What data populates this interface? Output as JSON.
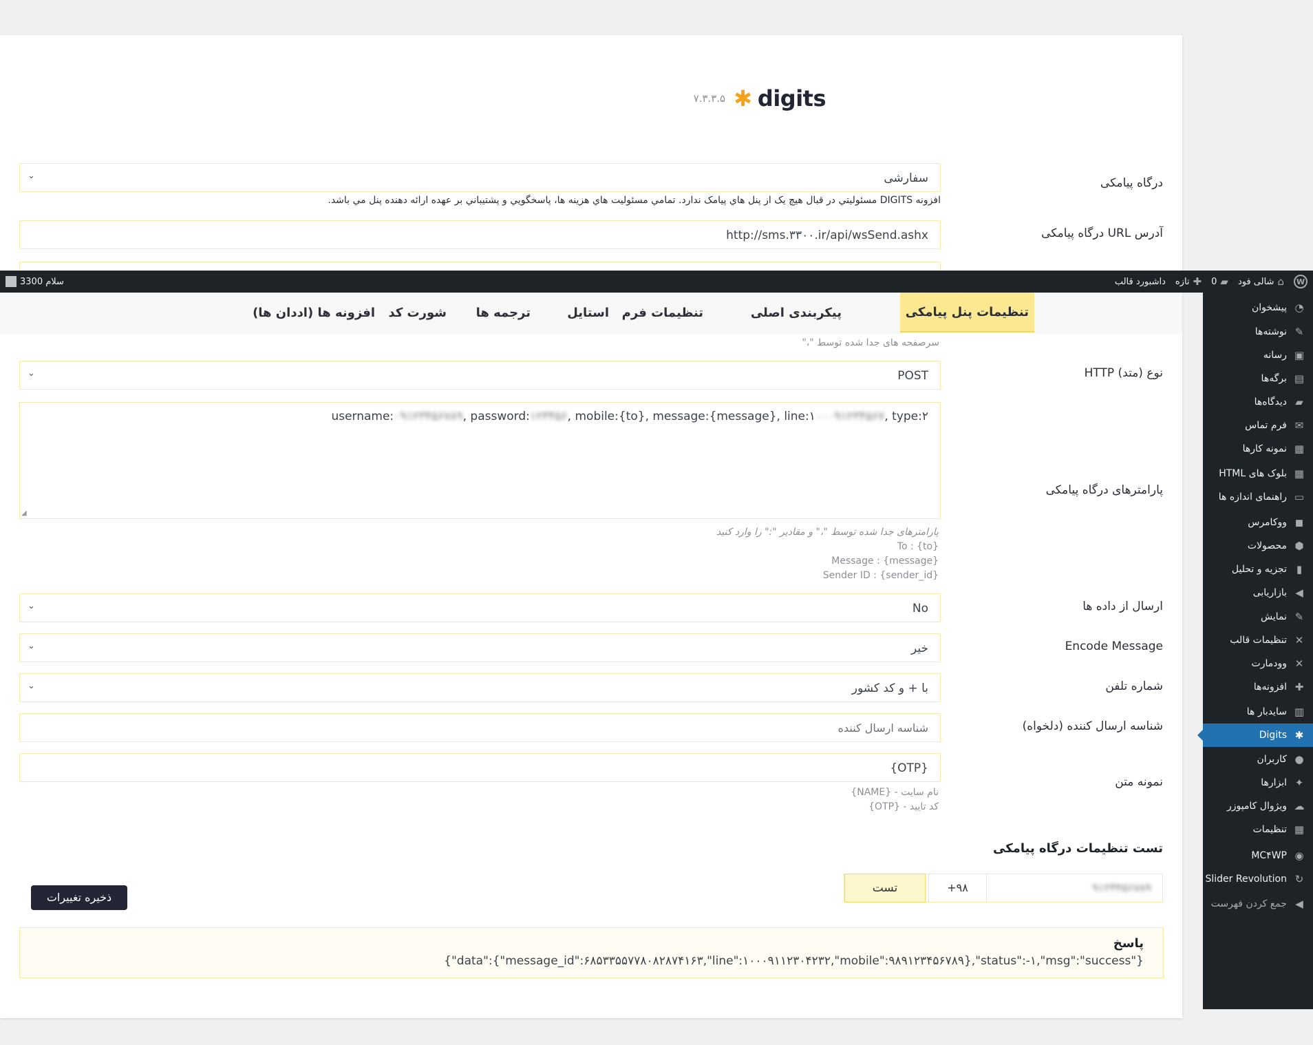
{
  "plugin": {
    "name": "digits",
    "version": "۷.۳.۳.۵"
  },
  "gateway": {
    "label": "درگاه پیامکی",
    "value": "سفارشی",
    "disclaimer": "افزونه DIGITS مسئوليتي در قبال هيچ يک از پنل هاي پيامک ندارد. تمامي مسئوليت هاي هزينه ها، پاسخگويي و پشتيباني بر عهده ارائه دهنده پنل مي باشد."
  },
  "gateway_url": {
    "label": "آدرس URL درگاه پیامکی",
    "value": "http://sms.۳۳۰۰.ir/api/wsSend.ashx"
  },
  "admin_bar": {
    "site_name": "شالی فود",
    "comments_count": "0",
    "new_label": "تازه",
    "dashboard_label": "داشبورد قالب",
    "greeting": "سلام 3300"
  },
  "tabs": [
    "تنظیمات پنل پیامکی",
    "پیکربندی اصلی",
    "تنظیمات فرم",
    "استایل",
    "ترجمه ها",
    "شورت کد",
    "افزونه ها (اددان ها)"
  ],
  "headers_help": "سرصفحه های جدا شده توسط \"،\"",
  "http_method": {
    "label": "نوع (متد) HTTP",
    "value": "POST"
  },
  "parameters": {
    "label": "پارامترهای درگاه پیامکی",
    "value_prefix": "username:",
    "value_user_blur": "۰۹۱۲۳۴۵۶۷۸۹",
    "value_mid1": ", password:",
    "value_pass_blur": "۱۲۳۴۵۶",
    "value_mid2": ", mobile:{to}, message:{message}, line:۱",
    "value_line_blur": "۰۰۰۹۱۲۳۴۵۶۷",
    "value_suffix": ", type:۲",
    "help": [
      "پارامترهای جدا شده توسط \"،\" و مقادیر \":\" را وارد کنید",
      "To : {to}",
      "Message : {message}",
      "Sender ID : {sender_id}"
    ]
  },
  "send_as_data": {
    "label": "ارسال از داده ها",
    "value": "No"
  },
  "encode_message": {
    "label": "Encode Message",
    "value": "خیر"
  },
  "phone_number": {
    "label": "شماره تلفن",
    "value": "با + و کد کشور"
  },
  "sender_id": {
    "label": "شناسه ارسال کننده (دلخواه)",
    "placeholder": "شناسه ارسال کننده"
  },
  "message_template": {
    "label": "نمونه متن",
    "value": "{OTP}",
    "help": [
      "نام سایت - {NAME}",
      "کد تایید - {OTP}"
    ]
  },
  "test_section": {
    "title": "تست تنظیمات درگاه پیامکی",
    "phone": "۹۱۲۳۴۵۶۷۸۹",
    "country_code": "+۹۸",
    "test_button": "تست"
  },
  "save_button": "ذخیره تغییرات",
  "response": {
    "title": "پاسخ",
    "value": "{\"data\":{\"message_id\":۶۸۵۳۳۵۵۷۷۸۰۸۲۸۷۴۱۶۳,\"line\":۱۰۰۰۹۱۱۲۳۰۴۲۳۲,\"mobile\":۹۸۹۱۲۳۴۵۶۷۸۹},\"status\":-۱,\"msg\":\"success\"}"
  },
  "sidebar": [
    {
      "label": "پیشخوان",
      "icon": "dashboard-icon"
    },
    {
      "label": "نوشته‌ها",
      "icon": "pin-icon"
    },
    {
      "label": "رسانه",
      "icon": "media-icon"
    },
    {
      "label": "برگه‌ها",
      "icon": "page-icon"
    },
    {
      "label": "دیدگاه‌ها",
      "icon": "comment-icon"
    },
    {
      "label": "فرم تماس",
      "icon": "mail-icon"
    },
    {
      "label": "نمونه کارها",
      "icon": "portfolio-icon"
    },
    {
      "label": "بلوک های HTML",
      "icon": "grid-icon"
    },
    {
      "label": "راهنمای اندازه ها",
      "icon": "ruler-icon"
    },
    {
      "label": "ووکامرس",
      "icon": "woo-icon"
    },
    {
      "label": "محصولات",
      "icon": "box-icon"
    },
    {
      "label": "تجزیه و تحلیل",
      "icon": "chart-icon"
    },
    {
      "label": "بازاریابی",
      "icon": "megaphone-icon"
    },
    {
      "label": "نمایش",
      "icon": "brush-icon"
    },
    {
      "label": "تنظیمات قالب",
      "icon": "theme-settings-icon"
    },
    {
      "label": "وودمارت",
      "icon": "woodmart-icon"
    },
    {
      "label": "افزونه‌ها",
      "icon": "plugin-icon"
    },
    {
      "label": "سایدبار ها",
      "icon": "sidebar-icon"
    },
    {
      "label": "Digits",
      "icon": "digits-icon"
    },
    {
      "label": "کاربران",
      "icon": "user-icon"
    },
    {
      "label": "ابزارها",
      "icon": "wrench-icon"
    },
    {
      "label": "ویژوال کامپوزر",
      "icon": "cloud-icon"
    },
    {
      "label": "تنظیمات",
      "icon": "settings-icon"
    },
    {
      "label": "MC۴WP",
      "icon": "mc4wp-icon"
    },
    {
      "label": "Slider Revolution",
      "icon": "refresh-icon"
    },
    {
      "label": "جمع کردن فهرست",
      "icon": "collapse-icon"
    }
  ]
}
